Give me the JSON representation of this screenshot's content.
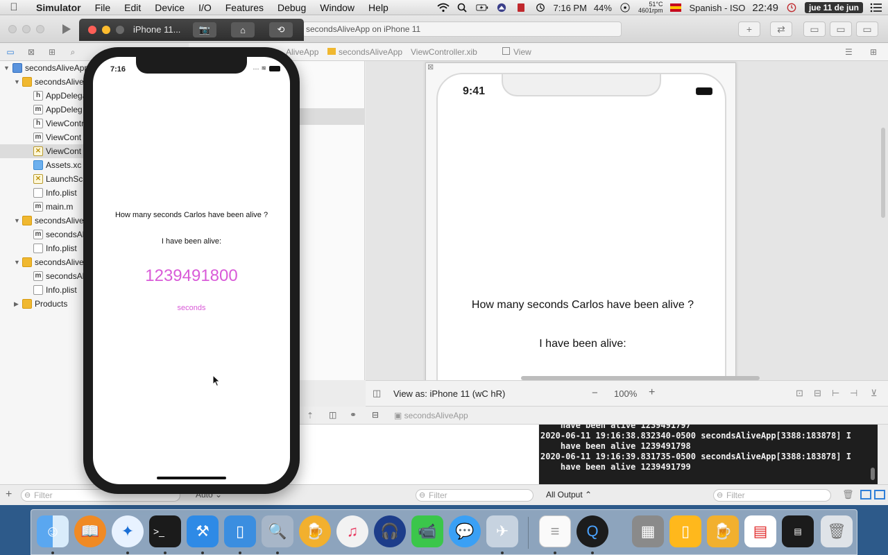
{
  "menubar": {
    "app_name": "Simulator",
    "menus": [
      "File",
      "Edit",
      "Device",
      "I/O",
      "Features",
      "Debug",
      "Window",
      "Help"
    ],
    "clock": "7:16 PM",
    "battery": "44%",
    "temp": "51°C",
    "rpm": "4601rpm",
    "input_source": "Spanish - ISO",
    "time_24": "22:49",
    "date": "jue 11 de jun"
  },
  "xcode": {
    "status_text": "secondsAliveApp on iPhone 11",
    "jumpbar": [
      "AliveApp",
      "secondsAliveApp",
      "ViewController.xib",
      "View"
    ],
    "navigator": {
      "items": [
        {
          "label": "secondsAliveApp",
          "kind": "project",
          "level": 0,
          "expanded": true
        },
        {
          "label": "secondsAlive",
          "kind": "folder",
          "level": 1,
          "expanded": true
        },
        {
          "label": "AppDelega",
          "kind": "h",
          "level": 2
        },
        {
          "label": "AppDeleg",
          "kind": "m",
          "level": 2
        },
        {
          "label": "ViewContr",
          "kind": "h",
          "level": 2
        },
        {
          "label": "ViewCont",
          "kind": "m",
          "level": 2
        },
        {
          "label": "ViewCont",
          "kind": "xib",
          "level": 2,
          "selected": true
        },
        {
          "label": "Assets.xc",
          "kind": "assets",
          "level": 2
        },
        {
          "label": "LaunchSc",
          "kind": "xib",
          "level": 2
        },
        {
          "label": "Info.plist",
          "kind": "plist",
          "level": 2
        },
        {
          "label": "main.m",
          "kind": "m",
          "level": 2
        },
        {
          "label": "secondsAlive",
          "kind": "folder",
          "level": 1,
          "expanded": true
        },
        {
          "label": "secondsAli",
          "kind": "m",
          "level": 2
        },
        {
          "label": "Info.plist",
          "kind": "plist",
          "level": 2
        },
        {
          "label": "secondsAlive",
          "kind": "folder",
          "level": 1,
          "expanded": true
        },
        {
          "label": "secondsAli",
          "kind": "m",
          "level": 2
        },
        {
          "label": "Info.plist",
          "kind": "plist",
          "level": 2
        },
        {
          "label": "Products",
          "kind": "folder",
          "level": 1,
          "expanded": false
        }
      ],
      "filter_placeholder": "Filter"
    },
    "canvas": {
      "device_time": "9:41",
      "question": "How many seconds Carlos have been alive ?",
      "alive_label": "I have been alive:",
      "view_as": "View as: iPhone 11",
      "size_class": "(wC hR)",
      "zoom": "100%"
    },
    "debug": {
      "target": "secondsAliveApp",
      "console_lines": [
        "    have been alive 1239491797",
        "2020-06-11 19:16:38.832340-0500 secondsAliveApp[3388:183878] I",
        "    have been alive 1239491798",
        "2020-06-11 19:16:39.831735-0500 secondsAliveApp[3388:183878] I",
        "    have been alive 1239491799"
      ],
      "variables_mode": "Auto",
      "variables_filter": "Filter",
      "output_mode": "All Output",
      "console_filter": "Filter"
    }
  },
  "simulator": {
    "title": "iPhone 11...",
    "time": "7:16",
    "question": "How many seconds Carlos have been alive ?",
    "alive_label": "I have been alive:",
    "count": "1239491800",
    "unit": "seconds",
    "accent": "#d95bd8"
  },
  "dock": {
    "apps": [
      "finder-icon",
      "books-icon",
      "safari-icon",
      "terminal-icon",
      "xcode-icon",
      "simulator-icon",
      "preview-icon",
      "beer-icon",
      "music-icon",
      "podcast-icon",
      "facetime-icon",
      "messages-icon",
      "migration-icon",
      "textedit-icon",
      "quicktime-icon",
      "photo-icon",
      "iphone-icon",
      "beer-icon",
      "files-icon",
      "console-icon",
      "trash-icon"
    ]
  }
}
